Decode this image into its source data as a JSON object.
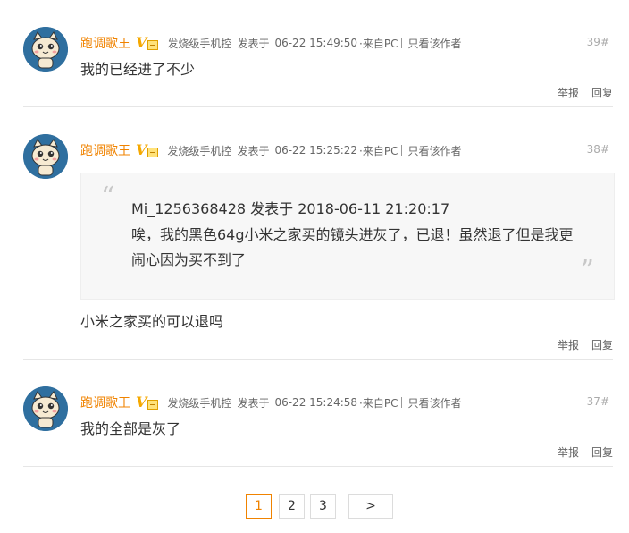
{
  "posts": [
    {
      "author": "跑调歌王",
      "level": "发烧级手机控",
      "posted_prefix": "发表于",
      "time": "06-22 15:49:50",
      "source": "·来自PC",
      "only_author": "只看该作者",
      "floor": "39#",
      "content": "我的已经进了不少",
      "report": "举报",
      "reply": "回复"
    },
    {
      "author": "跑调歌王",
      "level": "发烧级手机控",
      "posted_prefix": "发表于",
      "time": "06-22 15:25:22",
      "source": "·来自PC",
      "only_author": "只看该作者",
      "floor": "38#",
      "quote": {
        "header": "Mi_1256368428 发表于 2018-06-11 21:20:17",
        "line1": "唉，我的黑色64g小米之家买的镜头进灰了，已退！虽然退了但是我更",
        "line2": "闹心因为买不到了"
      },
      "content": "小米之家买的可以退吗",
      "report": "举报",
      "reply": "回复"
    },
    {
      "author": "跑调歌王",
      "level": "发烧级手机控",
      "posted_prefix": "发表于",
      "time": "06-22 15:24:58",
      "source": "·来自PC",
      "only_author": "只看该作者",
      "floor": "37#",
      "content": "我的全部是灰了",
      "report": "举报",
      "reply": "回复"
    }
  ],
  "pagination": {
    "pages": [
      "1",
      "2",
      "3"
    ],
    "current": "1",
    "next": ">"
  },
  "colors": {
    "author": "#f08300",
    "vip": "#f5a800",
    "avatar_bg": "#2f6f9f",
    "active_page": "#f08300"
  }
}
